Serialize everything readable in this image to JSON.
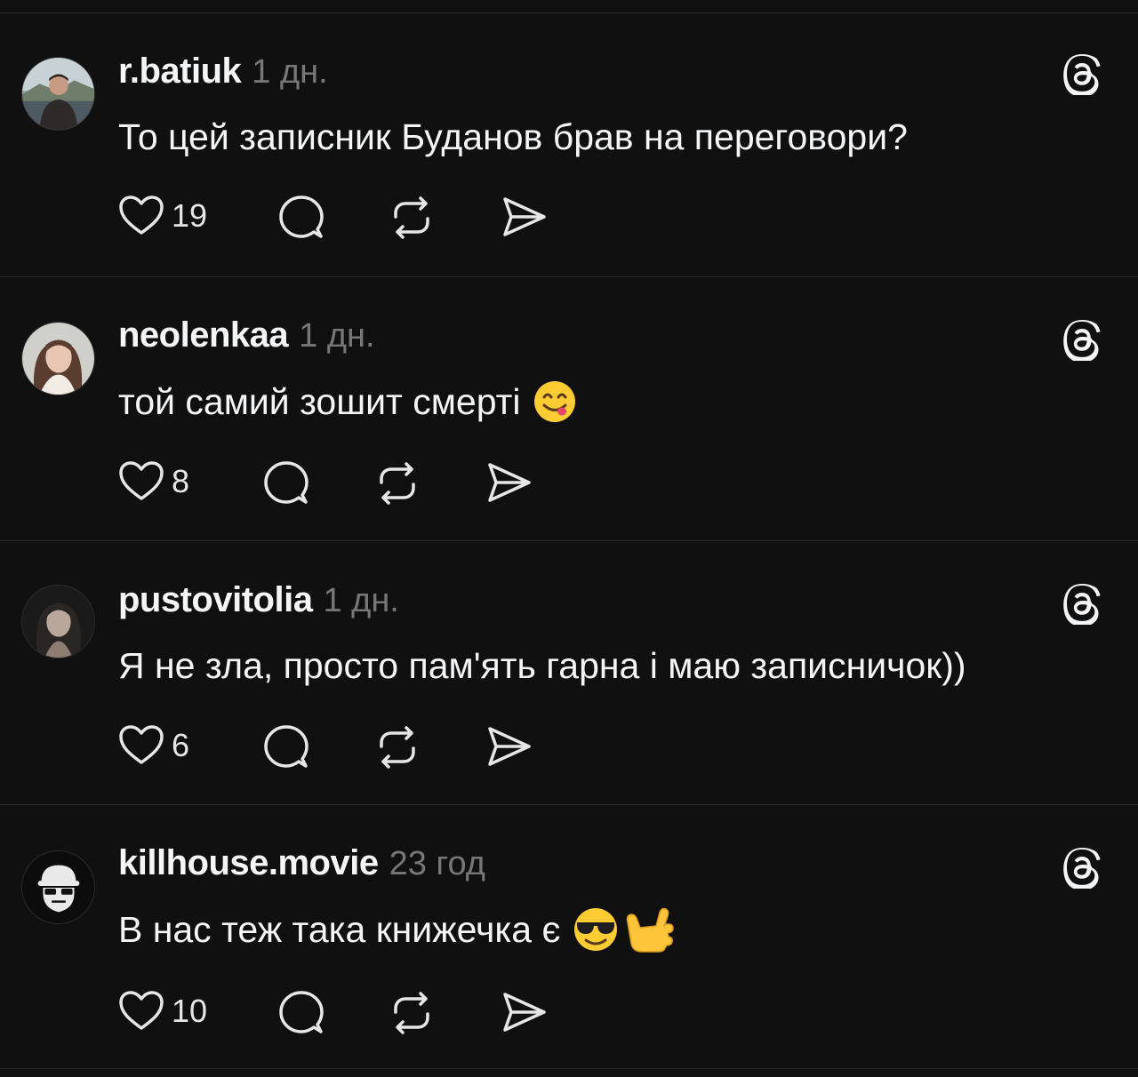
{
  "colors": {
    "background": "#101010",
    "text": "#f3f5f7",
    "muted": "#777777",
    "divider": "#2a2a2a"
  },
  "posts": [
    {
      "username": "r.batiuk",
      "time": "1 дн.",
      "text": "То  цей записник Буданов брав на переговори?",
      "emojis": [],
      "likes": "19",
      "avatar_icon": "man-avatar-photo"
    },
    {
      "username": "neolenkaa",
      "time": "1 дн.",
      "text": "той самий зошит смерті",
      "emojis": [
        "face-savoring-food-emoji"
      ],
      "likes": "8",
      "avatar_icon": "woman-avatar-photo"
    },
    {
      "username": "pustovitolia",
      "time": "1 дн.",
      "text": "Я не зла, просто пам'ять гарна і маю записничок))",
      "emojis": [],
      "likes": "6",
      "avatar_icon": "woman-dark-avatar-photo"
    },
    {
      "username": "killhouse.movie",
      "time": "23 год",
      "text": "В нас теж така книжечка є",
      "emojis": [
        "sunglasses-face-emoji",
        "call-me-hand-emoji"
      ],
      "likes": "10",
      "avatar_icon": "masked-figure-logo-avatar"
    }
  ],
  "actions": {
    "like_icon": "heart-icon",
    "reply_icon": "comment-bubble-icon",
    "repost_icon": "repost-icon",
    "share_icon": "send-icon",
    "app_icon": "threads-logo-icon"
  }
}
